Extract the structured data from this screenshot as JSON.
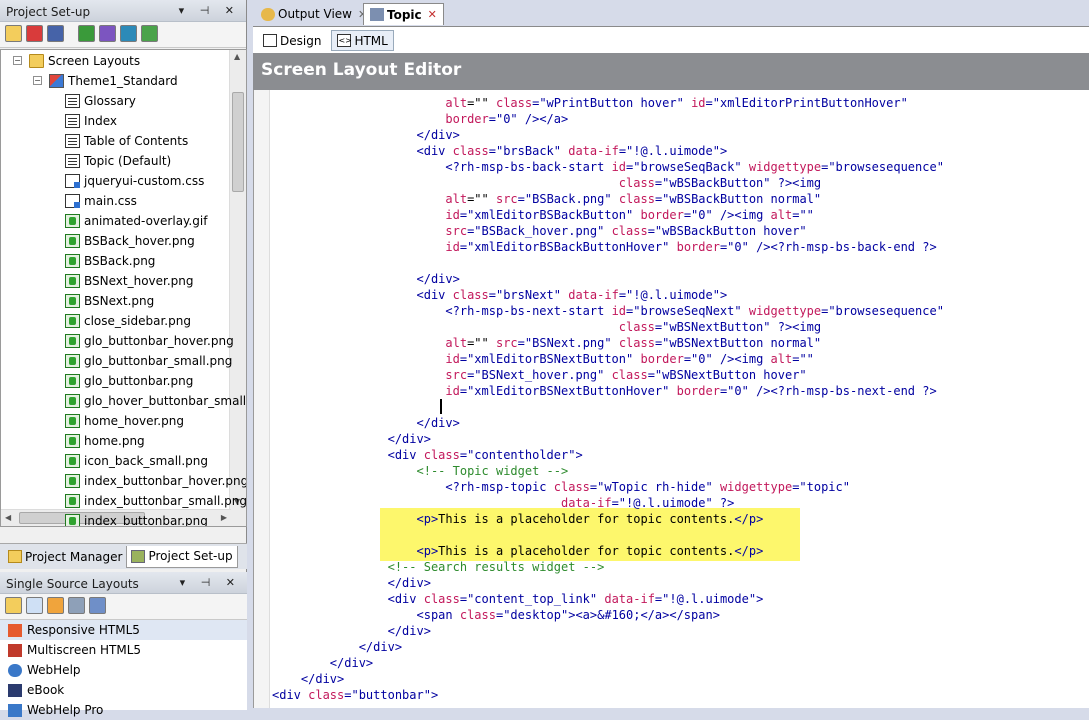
{
  "left_top_panel": {
    "title": "Project Set-up",
    "controls": "▾ ⊣ ✕"
  },
  "tree": [
    {
      "label": "Screen Layouts",
      "icon": "folder-icon",
      "toggle": "−"
    },
    {
      "label": "Theme1_Standard",
      "icon": "theme-icon",
      "toggle": "−"
    },
    {
      "label": "Glossary",
      "icon": "page-icon"
    },
    {
      "label": "Index",
      "icon": "page-icon"
    },
    {
      "label": "Table of Contents",
      "icon": "page-icon"
    },
    {
      "label": "Topic (Default)",
      "icon": "page-icon"
    },
    {
      "label": "jqueryui-custom.css",
      "icon": "css-icon"
    },
    {
      "label": "main.css",
      "icon": "css-icon"
    },
    {
      "label": "animated-overlay.gif",
      "icon": "image-icon"
    },
    {
      "label": "BSBack_hover.png",
      "icon": "image-icon"
    },
    {
      "label": "BSBack.png",
      "icon": "image-icon"
    },
    {
      "label": "BSNext_hover.png",
      "icon": "image-icon"
    },
    {
      "label": "BSNext.png",
      "icon": "image-icon"
    },
    {
      "label": "close_sidebar.png",
      "icon": "image-icon"
    },
    {
      "label": "glo_buttonbar_hover.png",
      "icon": "image-icon"
    },
    {
      "label": "glo_buttonbar_small.png",
      "icon": "image-icon"
    },
    {
      "label": "glo_buttonbar.png",
      "icon": "image-icon"
    },
    {
      "label": "glo_hover_buttonbar_small.pn",
      "icon": "image-icon"
    },
    {
      "label": "home_hover.png",
      "icon": "image-icon"
    },
    {
      "label": "home.png",
      "icon": "image-icon"
    },
    {
      "label": "icon_back_small.png",
      "icon": "image-icon"
    },
    {
      "label": "index_buttonbar_hover.png",
      "icon": "image-icon"
    },
    {
      "label": "index_buttonbar_small.png",
      "icon": "image-icon"
    },
    {
      "label": "index_buttonbar.png",
      "icon": "image-icon"
    }
  ],
  "bottom_tabs": [
    "Project Manager",
    "Project Set-up"
  ],
  "left_bottom_panel": {
    "title": "Single Source Layouts",
    "controls": "▾ ⊣ ✕"
  },
  "layouts": [
    "Responsive HTML5",
    "Multiscreen HTML5",
    "WebHelp",
    "eBook",
    "WebHelp Pro"
  ],
  "doc_tabs": [
    {
      "label": "Output View"
    },
    {
      "label": "Topic"
    }
  ],
  "view_buttons": [
    "Design",
    "HTML"
  ],
  "editor_title": "Screen Layout Editor",
  "code_lines": [
    [
      [
        "                        ",
        "#000"
      ],
      [
        "alt",
        "#c2185b"
      ],
      [
        "=\"\" ",
        "#000"
      ],
      [
        "class",
        "#c2185b"
      ],
      [
        "=\"wPrintButton hover\" ",
        "#0000a0"
      ],
      [
        "id",
        "#c2185b"
      ],
      [
        "=\"xmlEditorPrintButtonHover\"",
        "#0000a0"
      ]
    ],
    [
      [
        "                        ",
        "#000"
      ],
      [
        "border",
        "#c2185b"
      ],
      [
        "=\"0\" /></a>",
        "#0000a0"
      ]
    ],
    [
      [
        "                    </div>",
        "#0000a0"
      ]
    ],
    [
      [
        "                    <div ",
        "#0000a0"
      ],
      [
        "class",
        "#c2185b"
      ],
      [
        "=\"brsBack\" ",
        "#0000a0"
      ],
      [
        "data-if",
        "#c2185b"
      ],
      [
        "=\"!@.l.uimode\">",
        "#0000a0"
      ]
    ],
    [
      [
        "                        <?rh-msp-bs-back-start ",
        "#0000a0"
      ],
      [
        "id",
        "#c2185b"
      ],
      [
        "=\"browseSeqBack\" ",
        "#0000a0"
      ],
      [
        "widgettype",
        "#c2185b"
      ],
      [
        "=\"browsesequence\"",
        "#0000a0"
      ]
    ],
    [
      [
        "                                                ",
        "#000"
      ],
      [
        "class",
        "#c2185b"
      ],
      [
        "=\"wBSBackButton\" ?><img",
        "#0000a0"
      ]
    ],
    [
      [
        "                        ",
        "#000"
      ],
      [
        "alt",
        "#c2185b"
      ],
      [
        "=\"\" ",
        "#000"
      ],
      [
        "src",
        "#c2185b"
      ],
      [
        "=\"BSBack.png\" ",
        "#0000a0"
      ],
      [
        "class",
        "#c2185b"
      ],
      [
        "=\"wBSBackButton normal\"",
        "#0000a0"
      ]
    ],
    [
      [
        "                        ",
        "#000"
      ],
      [
        "id",
        "#c2185b"
      ],
      [
        "=\"xmlEditorBSBackButton\" ",
        "#0000a0"
      ],
      [
        "border",
        "#c2185b"
      ],
      [
        "=\"0\" /><img ",
        "#0000a0"
      ],
      [
        "alt",
        "#c2185b"
      ],
      [
        "=\"\"",
        "#0000a0"
      ]
    ],
    [
      [
        "                        ",
        "#000"
      ],
      [
        "src",
        "#c2185b"
      ],
      [
        "=\"BSBack_hover.png\" ",
        "#0000a0"
      ],
      [
        "class",
        "#c2185b"
      ],
      [
        "=\"wBSBackButton hover\"",
        "#0000a0"
      ]
    ],
    [
      [
        "                        ",
        "#000"
      ],
      [
        "id",
        "#c2185b"
      ],
      [
        "=\"xmlEditorBSBackButtonHover\" ",
        "#0000a0"
      ],
      [
        "border",
        "#c2185b"
      ],
      [
        "=\"0\" /><?rh-msp-bs-back-end ?>",
        "#0000a0"
      ]
    ],
    [
      [
        "",
        "#000"
      ]
    ],
    [
      [
        "                    </div>",
        "#0000a0"
      ]
    ],
    [
      [
        "                    <div ",
        "#0000a0"
      ],
      [
        "class",
        "#c2185b"
      ],
      [
        "=\"brsNext\" ",
        "#0000a0"
      ],
      [
        "data-if",
        "#c2185b"
      ],
      [
        "=\"!@.l.uimode\">",
        "#0000a0"
      ]
    ],
    [
      [
        "                        <?rh-msp-bs-next-start ",
        "#0000a0"
      ],
      [
        "id",
        "#c2185b"
      ],
      [
        "=\"browseSeqNext\" ",
        "#0000a0"
      ],
      [
        "widgettype",
        "#c2185b"
      ],
      [
        "=\"browsesequence\"",
        "#0000a0"
      ]
    ],
    [
      [
        "                                                ",
        "#000"
      ],
      [
        "class",
        "#c2185b"
      ],
      [
        "=\"wBSNextButton\" ?><img",
        "#0000a0"
      ]
    ],
    [
      [
        "                        ",
        "#000"
      ],
      [
        "alt",
        "#c2185b"
      ],
      [
        "=\"\" ",
        "#000"
      ],
      [
        "src",
        "#c2185b"
      ],
      [
        "=\"BSNext.png\" ",
        "#0000a0"
      ],
      [
        "class",
        "#c2185b"
      ],
      [
        "=\"wBSNextButton normal\"",
        "#0000a0"
      ]
    ],
    [
      [
        "                        ",
        "#000"
      ],
      [
        "id",
        "#c2185b"
      ],
      [
        "=\"xmlEditorBSNextButton\" ",
        "#0000a0"
      ],
      [
        "border",
        "#c2185b"
      ],
      [
        "=\"0\" /><img ",
        "#0000a0"
      ],
      [
        "alt",
        "#c2185b"
      ],
      [
        "=\"\"",
        "#0000a0"
      ]
    ],
    [
      [
        "                        ",
        "#000"
      ],
      [
        "src",
        "#c2185b"
      ],
      [
        "=\"BSNext_hover.png\" ",
        "#0000a0"
      ],
      [
        "class",
        "#c2185b"
      ],
      [
        "=\"wBSNextButton hover\"",
        "#0000a0"
      ]
    ],
    [
      [
        "                        ",
        "#000"
      ],
      [
        "id",
        "#c2185b"
      ],
      [
        "=\"xmlEditorBSNextButtonHover\" ",
        "#0000a0"
      ],
      [
        "border",
        "#c2185b"
      ],
      [
        "=\"0\" /><?rh-msp-bs-next-end ?>",
        "#0000a0"
      ]
    ],
    [
      [
        "",
        "#000"
      ]
    ],
    [
      [
        "                    </div>",
        "#0000a0"
      ]
    ],
    [
      [
        "                </div>",
        "#0000a0"
      ]
    ],
    [
      [
        "                <div ",
        "#0000a0"
      ],
      [
        "class",
        "#c2185b"
      ],
      [
        "=\"contentholder\">",
        "#0000a0"
      ]
    ],
    [
      [
        "                    <!-- Topic widget -->",
        "#2e8b2e"
      ]
    ],
    [
      [
        "                        <?rh-msp-topic ",
        "#0000a0"
      ],
      [
        "class",
        "#c2185b"
      ],
      [
        "=\"wTopic rh-hide\" ",
        "#0000a0"
      ],
      [
        "widgettype",
        "#c2185b"
      ],
      [
        "=\"topic\"",
        "#0000a0"
      ]
    ],
    [
      [
        "                                        ",
        "#000"
      ],
      [
        "data-if",
        "#c2185b"
      ],
      [
        "=\"!@.l.uimode\" ?>",
        "#0000a0"
      ]
    ],
    [
      [
        "                    <p>",
        "#0000a0"
      ],
      [
        "This is a placeholder for topic contents.",
        "#000"
      ],
      [
        "</p>",
        "#0000a0"
      ]
    ],
    [
      [
        "",
        "#000"
      ]
    ],
    [
      [
        "                    <p>",
        "#0000a0"
      ],
      [
        "This is a placeholder for topic contents.",
        "#000"
      ],
      [
        "</p>",
        "#0000a0"
      ]
    ],
    [
      [
        "                <!-- Search results widget -->",
        "#2e8b2e"
      ]
    ],
    [
      [
        "                </div>",
        "#0000a0"
      ]
    ],
    [
      [
        "                <div ",
        "#0000a0"
      ],
      [
        "class",
        "#c2185b"
      ],
      [
        "=\"content_top_link\" ",
        "#0000a0"
      ],
      [
        "data-if",
        "#c2185b"
      ],
      [
        "=\"!@.l.uimode\">",
        "#0000a0"
      ]
    ],
    [
      [
        "                    <span ",
        "#0000a0"
      ],
      [
        "class",
        "#c2185b"
      ],
      [
        "=\"desktop\"><a>&#160;</a></span>",
        "#0000a0"
      ]
    ],
    [
      [
        "                </div>",
        "#0000a0"
      ]
    ],
    [
      [
        "            </div>",
        "#0000a0"
      ]
    ],
    [
      [
        "        </div>",
        "#0000a0"
      ]
    ],
    [
      [
        "    </div>",
        "#0000a0"
      ]
    ],
    [
      [
        "<div ",
        "#0000a0"
      ],
      [
        "class",
        "#c2185b"
      ],
      [
        "=\"buttonbar\">",
        "#0000a0"
      ]
    ]
  ]
}
